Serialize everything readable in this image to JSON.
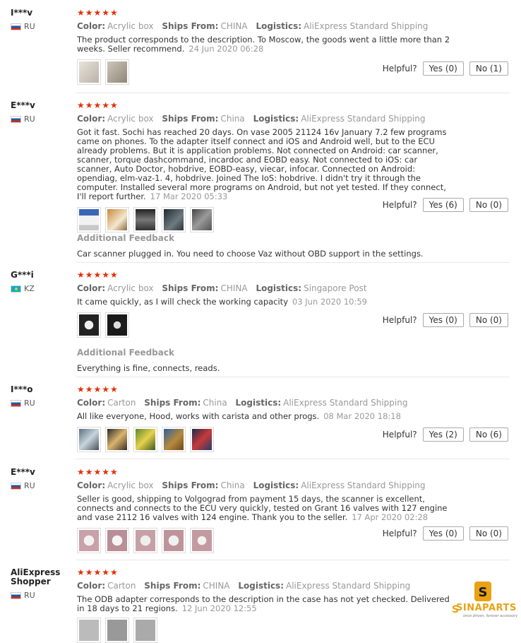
{
  "labels": {
    "color": "Color:",
    "ships_from": "Ships From:",
    "logistics": "Logistics:",
    "helpful": "Helpful?",
    "additional_feedback": "Additional Feedback",
    "stars": "★★★★★"
  },
  "reviews": [
    {
      "user": "I***v",
      "country": "RU",
      "rating": 5,
      "color": "Acrylic box",
      "ships_from": "CHINA",
      "logistics": "AliExpress Standard Shipping",
      "text": "The product corresponds to the description. To Moscow, the goods went a little more than 2 weeks. Seller recommend.",
      "date": "24 Jun 2020 06:28",
      "yes": "Yes (0)",
      "no": "No (1)"
    },
    {
      "user": "E***v",
      "country": "RU",
      "rating": 5,
      "color": "Acrylic box",
      "ships_from": "China",
      "logistics": "AliExpress Standard Shipping",
      "text": "Got it fast. Sochi has reached 20 days. On vase 2005 21124 16v January 7.2 few programs came on phones. To the adapter itself connect and iOS and Android well, but to the ECU already problems. But it is application problems. Not connected on Android: car scanner, scanner, torque dashcommand, incardoc and EOBD easy. Not connected to iOS: car scanner, Auto Doctor, hobdrive, EOBD-easy, viecar, infocar. Connected on Android: opendiag, elm-vaz-1. 4, hobdrive. Joined The IoS: hobdrive. I didn't try it through the computer. Installed several more programs on Android, but not yet tested. If they connect, I'll report further.",
      "date": "17 Mar 2020 05:33",
      "yes": "Yes (6)",
      "no": "No (0)",
      "additional": "Car scanner plugged in. You need to choose Vaz without OBD support in the settings."
    },
    {
      "user": "G***i",
      "country": "KZ",
      "rating": 5,
      "color": "Acrylic box",
      "ships_from": "CHINA",
      "logistics": "Singapore Post",
      "text": "It came quickly, as I will check the working capacity",
      "date": "03 Jun 2020 10:59",
      "yes": "Yes (0)",
      "no": "No (0)",
      "additional": "Everything is fine, connects, reads."
    },
    {
      "user": "I***o",
      "country": "RU",
      "rating": 5,
      "color": "Carton",
      "ships_from": "China",
      "logistics": "AliExpress Standard Shipping",
      "text": "All like everyone, Hood, works with carista and other progs.",
      "date": "08 Mar 2020 18:18",
      "yes": "Yes (2)",
      "no": "No (6)"
    },
    {
      "user": "E***v",
      "country": "RU",
      "rating": 5,
      "color": "Acrylic box",
      "ships_from": "China",
      "logistics": "AliExpress Standard Shipping",
      "text": "Seller is good, shipping to Volgograd from payment 15 days, the scanner is excellent, connects and connects to the ECU very quickly, tested on Grant 16 valves with 127 engine and vase 2112 16 valves with 124 engine. Thank you to the seller.",
      "date": "17 Apr 2020 02:28",
      "yes": "Yes (0)",
      "no": "No (0)"
    },
    {
      "user": "AliExpress Shopper",
      "country": "RU",
      "rating": 5,
      "color": "Carton",
      "ships_from": "CHINA",
      "logistics": "AliExpress Standard Shipping",
      "text": "The ODB adapter corresponds to the description in the case has not yet checked. Delivered in 18 days to 21 regions.",
      "date": "12 Jun 2020 12:55"
    }
  ],
  "watermark": {
    "brand": "SINAPARTS",
    "tagline": "once driven, forever accessory"
  }
}
